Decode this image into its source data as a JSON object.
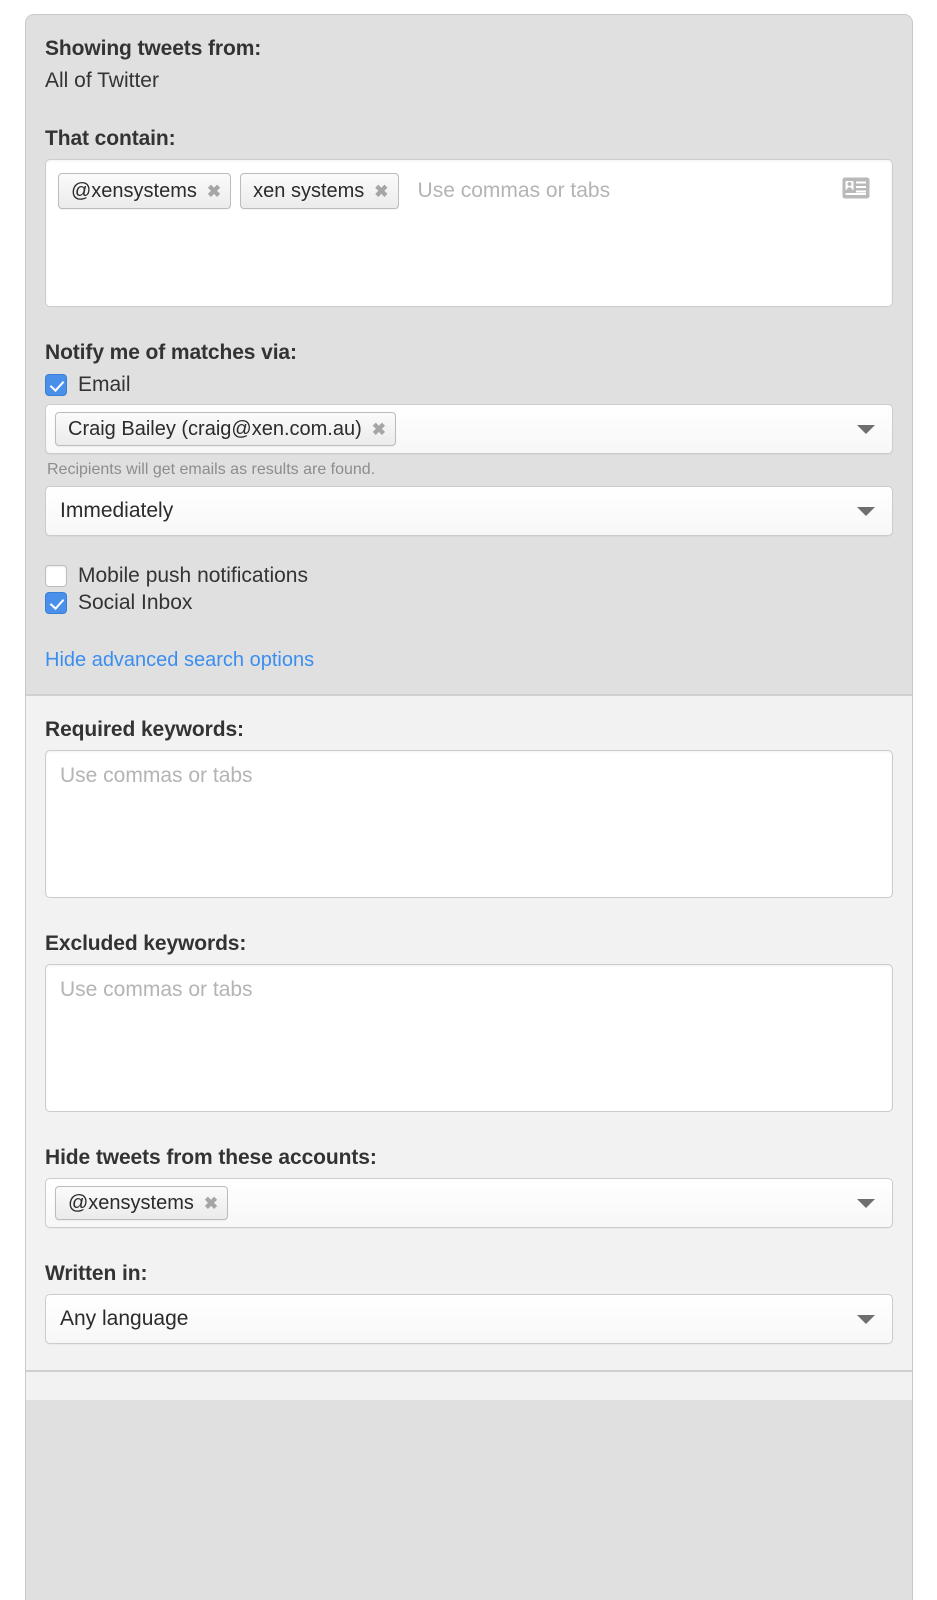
{
  "panel": {
    "basic": {
      "showing_from_label": "Showing tweets from:",
      "showing_from_value": "All of Twitter",
      "that_contain_label": "That contain:",
      "contain_tokens": [
        "@xensystems",
        "xen systems"
      ],
      "contain_placeholder": "Use commas or tabs",
      "contact_icon": "contact-card-icon",
      "notify_label": "Notify me of matches via:",
      "email_checkbox_label": "Email",
      "email_checked": true,
      "recipient_token": "Craig Bailey (craig@xen.com.au)",
      "recipients_help": "Recipients will get emails as results are found.",
      "frequency_value": "Immediately",
      "mobile_push_label": "Mobile push notifications",
      "mobile_push_checked": false,
      "social_inbox_label": "Social Inbox",
      "social_inbox_checked": true,
      "advanced_toggle_label": "Hide advanced search options"
    },
    "advanced": {
      "required_keywords_label": "Required keywords:",
      "required_keywords_placeholder": "Use commas or tabs",
      "excluded_keywords_label": "Excluded keywords:",
      "excluded_keywords_placeholder": "Use commas or tabs",
      "hide_accounts_label": "Hide tweets from these accounts:",
      "hide_accounts_token": "@xensystems",
      "written_in_label": "Written in:",
      "written_in_value": "Any language"
    },
    "token_remove_glyph": "✖",
    "colors": {
      "accent_blue": "#4a90ea",
      "link_blue": "#3b8ef0",
      "section_basic_bg": "#e0e0e0",
      "section_advanced_bg": "#f2f2f2",
      "label_text": "#333333",
      "placeholder_text": "#b4b4b4"
    }
  }
}
